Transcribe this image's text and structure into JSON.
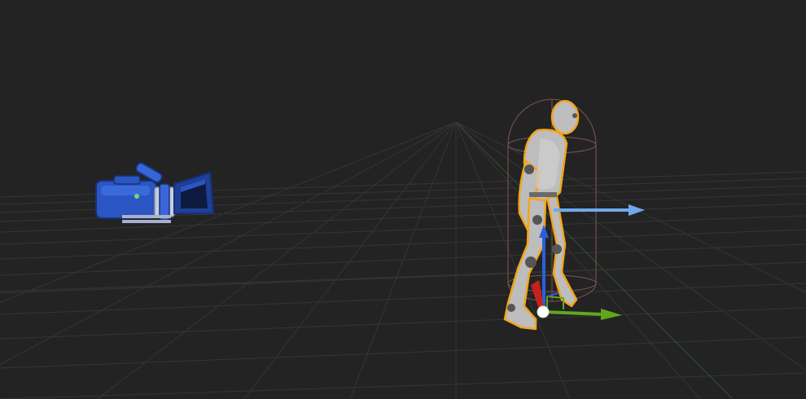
{
  "viewport": {
    "background_color": "#232323",
    "grid_color": "#3a3a3a",
    "grid_axis_color": "#2f4a2f"
  },
  "scene": {
    "camera_actor": {
      "icon": "camera-icon",
      "color": "#2f5fd0",
      "selected": false
    },
    "character_actor": {
      "icon": "character-mannequin-icon",
      "color": "#b8b8b8",
      "selected": true,
      "selection_outline_color": "#f2a51a",
      "capsule_color": "#8a5a5a"
    },
    "transform_gizmo": {
      "mode": "translate",
      "x_axis_color": "#c8201c",
      "y_axis_color": "#5fa81e",
      "z_axis_color": "#2b5fd8",
      "forward_arrow_color": "#6fa9ea"
    }
  }
}
